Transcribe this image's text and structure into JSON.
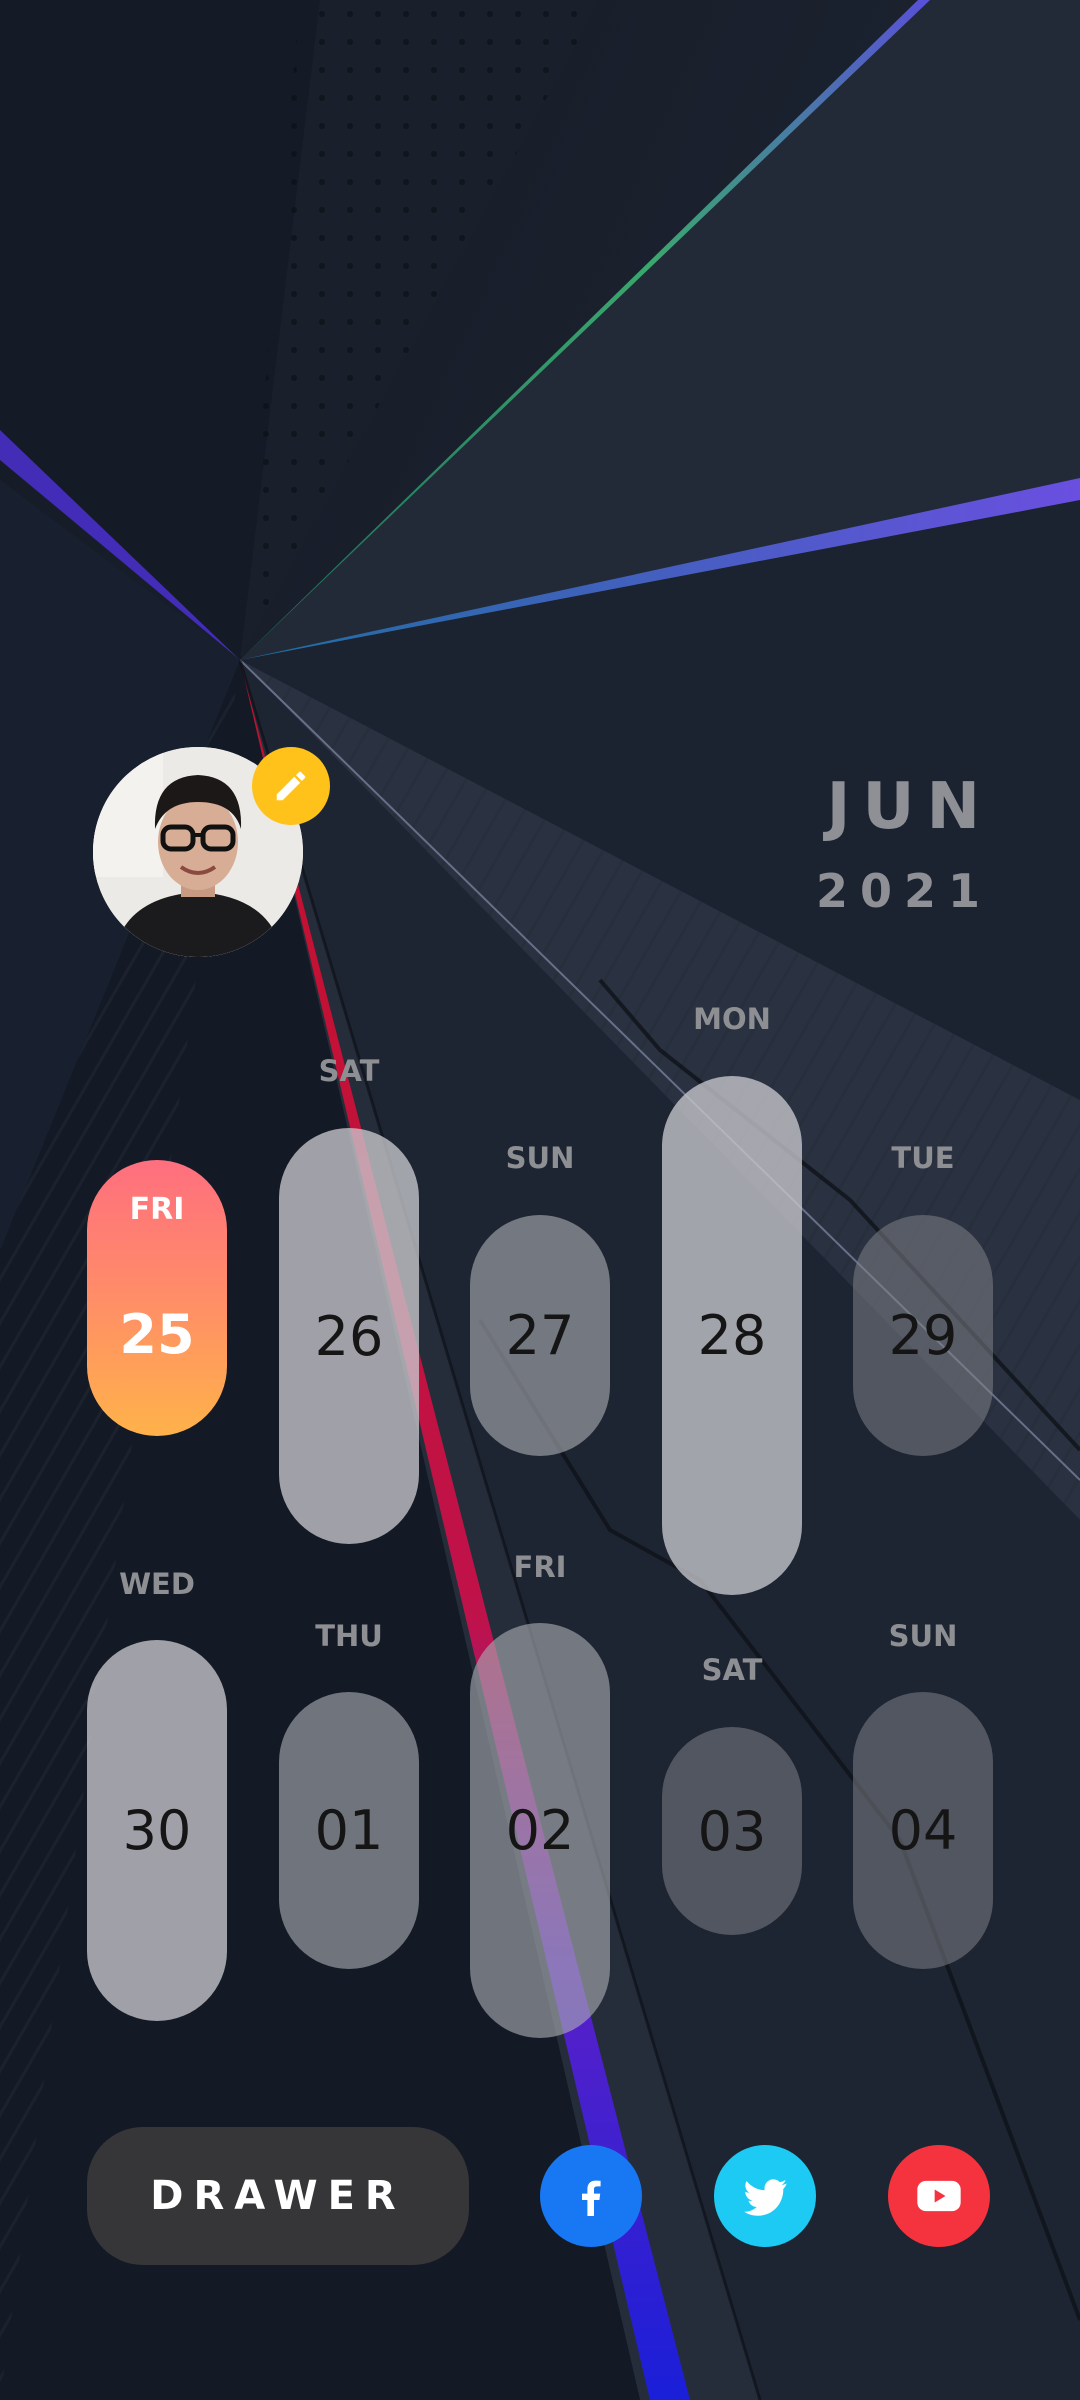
{
  "header": {
    "month": "JUN",
    "year": "2021"
  },
  "colors": {
    "today_gradient_top": "#ff6f7f",
    "today_gradient_bottom": "#ffb24a",
    "edit_badge": "#ffc21a",
    "facebook": "#1877f2",
    "twitter": "#1ccaf4",
    "youtube": "#f5333f",
    "drawer_bg": "#363638"
  },
  "today": {
    "day": "FRI",
    "date": "25"
  },
  "week1": [
    {
      "day": "SAT",
      "date": "26"
    },
    {
      "day": "SUN",
      "date": "27"
    },
    {
      "day": "MON",
      "date": "28"
    },
    {
      "day": "TUE",
      "date": "29"
    }
  ],
  "week2": [
    {
      "day": "WED",
      "date": "30"
    },
    {
      "day": "THU",
      "date": "01"
    },
    {
      "day": "FRI",
      "date": "02"
    },
    {
      "day": "SAT",
      "date": "03"
    },
    {
      "day": "SUN",
      "date": "04"
    }
  ],
  "bottom": {
    "drawer_label": "DRAWER"
  },
  "icons": {
    "edit": "pencil-icon",
    "facebook": "facebook-icon",
    "twitter": "twitter-icon",
    "youtube": "youtube-icon"
  }
}
